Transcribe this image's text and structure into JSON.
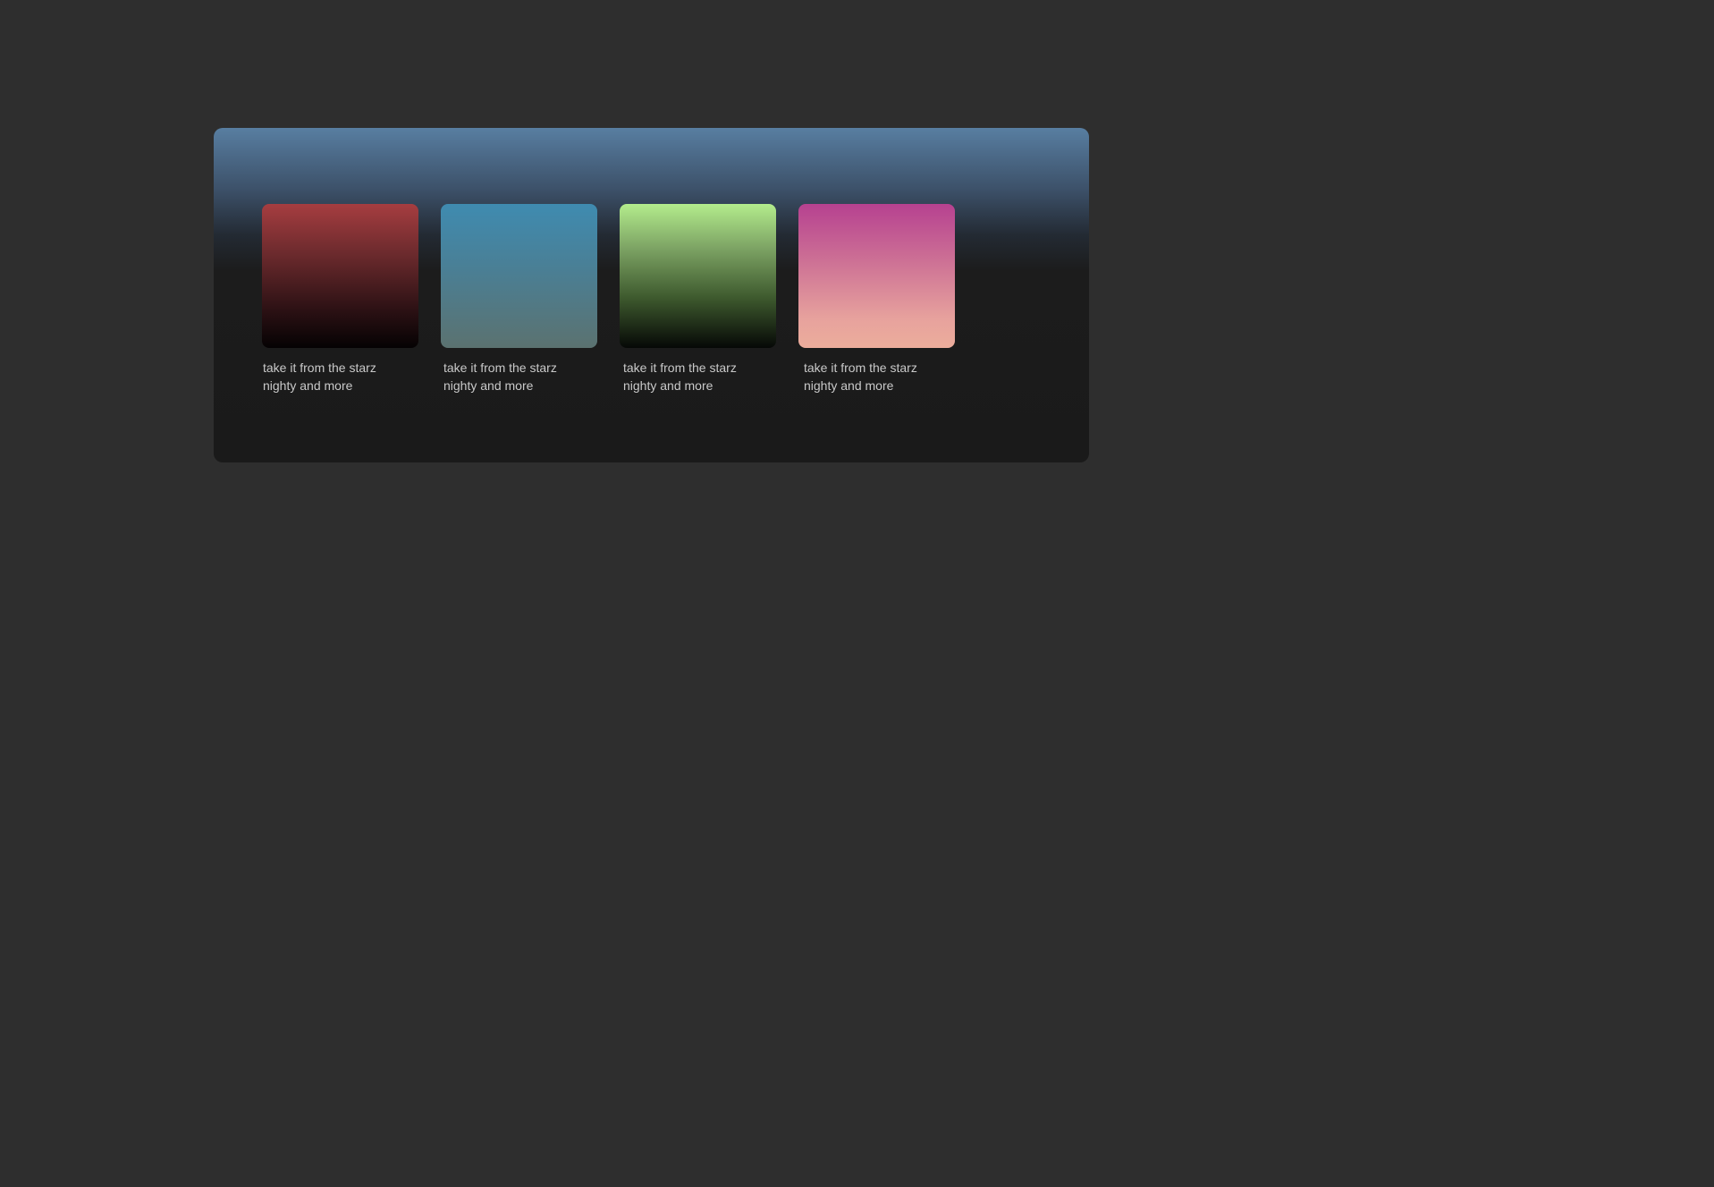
{
  "colors": {
    "page_background": "#2e2e2e",
    "panel_top": "#587ea1",
    "panel_bottom": "#1a1a1a",
    "caption_text": "#c9c9c9"
  },
  "cards": [
    {
      "line1": "take it from the starz",
      "line2": "nighty and more",
      "art": "red-to-black-gradient"
    },
    {
      "line1": "take it from the starz",
      "line2": "nighty and more",
      "art": "blue-to-slate-gradient"
    },
    {
      "line1": "take it from the starz",
      "line2": "nighty and more",
      "art": "lime-to-black-gradient"
    },
    {
      "line1": "take it from the starz",
      "line2": "nighty and more",
      "art": "magenta-to-peach-gradient"
    }
  ]
}
